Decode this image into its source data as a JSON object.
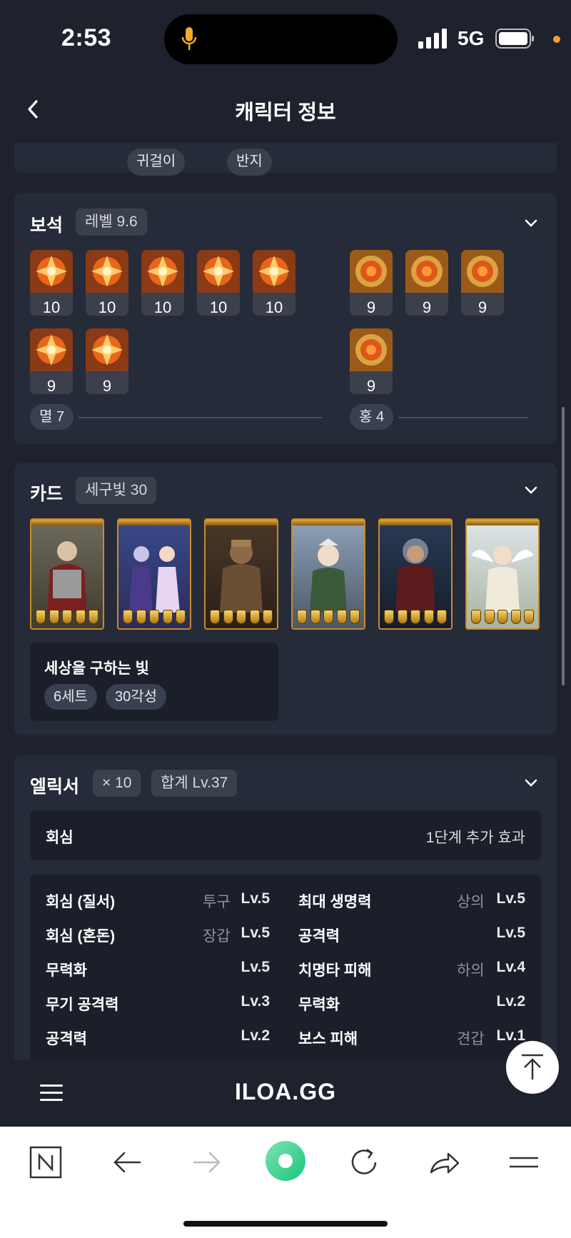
{
  "status_bar": {
    "time": "2:53",
    "network": "5G"
  },
  "header": {
    "title": "캐릭터 정보"
  },
  "accessory_tabs": [
    "귀걸이",
    "반지"
  ],
  "gems": {
    "title": "보석",
    "level_chip": "레벨 9.6",
    "left_levels_row1": [
      "10",
      "10",
      "10",
      "10",
      "10"
    ],
    "left_levels_row2": [
      "9",
      "9"
    ],
    "right_levels_row1": [
      "9",
      "9",
      "9"
    ],
    "right_levels_row2": [
      "9"
    ],
    "left_summary": "멸 7",
    "right_summary": "홍 4"
  },
  "cards": {
    "title": "카드",
    "awakening_chip": "세구빛 30",
    "set_name": "세상을 구하는 빛",
    "set_count": "6세트",
    "set_awaken": "30각성"
  },
  "elixir": {
    "title": "엘릭서",
    "count_chip": "× 10",
    "total_chip": "합계 Lv.37",
    "effect_name": "회심",
    "effect_desc": "1단계 추가 효과",
    "left": [
      {
        "name": "회심 (질서)",
        "slot": "투구",
        "level": "Lv.5"
      },
      {
        "name": "회심 (혼돈)",
        "slot": "장갑",
        "level": "Lv.5"
      },
      {
        "name": "무력화",
        "slot": "",
        "level": "Lv.5"
      },
      {
        "name": "무기 공격력",
        "slot": "",
        "level": "Lv.3"
      },
      {
        "name": "공격력",
        "slot": "",
        "level": "Lv.2"
      }
    ],
    "right": [
      {
        "name": "최대 생명력",
        "slot": "상의",
        "level": "Lv.5"
      },
      {
        "name": "공격력",
        "slot": "",
        "level": "Lv.5"
      },
      {
        "name": "치명타 피해",
        "slot": "하의",
        "level": "Lv.4"
      },
      {
        "name": "무력화",
        "slot": "",
        "level": "Lv.2"
      },
      {
        "name": "보스 피해",
        "slot": "견갑",
        "level": "Lv.1"
      }
    ]
  },
  "site": {
    "logo": "ILOA.GG"
  },
  "colors": {
    "background": "#1d222d",
    "panel": "#252b38",
    "card_border": "#c98a2a",
    "accent_green": "#2fd48a"
  }
}
